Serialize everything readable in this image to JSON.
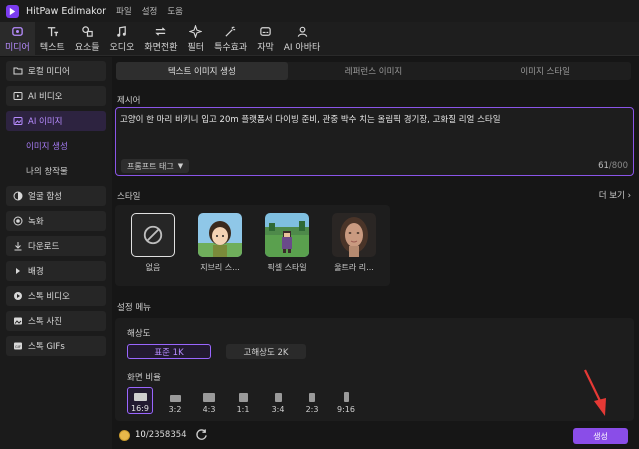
{
  "app": {
    "title": "HitPaw Edimakor",
    "menus": [
      "파일",
      "설정",
      "도움"
    ]
  },
  "toolbar": {
    "items": [
      {
        "label": "미디어",
        "icon": "media-icon",
        "active": true
      },
      {
        "label": "텍스트",
        "icon": "text-icon"
      },
      {
        "label": "요소들",
        "icon": "elements-icon"
      },
      {
        "label": "오디오",
        "icon": "audio-icon"
      },
      {
        "label": "화면전환",
        "icon": "transition-icon"
      },
      {
        "label": "필터",
        "icon": "filter-icon"
      },
      {
        "label": "특수효과",
        "icon": "effects-icon"
      },
      {
        "label": "자막",
        "icon": "subtitle-icon"
      },
      {
        "label": "AI 아바타",
        "icon": "avatar-icon"
      }
    ]
  },
  "sidebar": {
    "items": [
      {
        "label": "로컬 미디어",
        "icon": "folder-icon"
      },
      {
        "label": "AI 비디오",
        "icon": "ai-video-icon"
      },
      {
        "label": "AI 이미지",
        "icon": "ai-image-icon",
        "active": true
      },
      {
        "label": "이미지 생성",
        "sub": true,
        "active": true
      },
      {
        "label": "나의 창작물",
        "sub": true
      },
      {
        "label": "얼굴 합성",
        "icon": "face-swap-icon"
      },
      {
        "label": "녹화",
        "icon": "record-icon"
      },
      {
        "label": "다운로드",
        "icon": "download-icon"
      },
      {
        "label": "배경",
        "icon": "background-icon"
      },
      {
        "label": "스톡 비디오",
        "icon": "stock-video-icon"
      },
      {
        "label": "스톡 사진",
        "icon": "stock-photo-icon"
      },
      {
        "label": "스톡 GIFs",
        "icon": "gif-icon"
      }
    ]
  },
  "tabs": [
    "텍스트 이미지 생성",
    "레퍼런스 이미지",
    "이미지 스타일"
  ],
  "prompt": {
    "label": "제시어",
    "text": "고양이 한 마리 비키니 입고 20m 플랫폼서 다이빙 준비, 관중 박수 치는 올림픽 경기장, 고화질 리얼 스타일",
    "tag_button": "프롬프트 태그",
    "count": "61",
    "max": "/800"
  },
  "style": {
    "label": "스타일",
    "more": "더 보기",
    "options": [
      {
        "name": "없음",
        "selected": true
      },
      {
        "name": "지브리 스..."
      },
      {
        "name": "픽셀 스타일"
      },
      {
        "name": "울트라 리..."
      }
    ]
  },
  "settings": {
    "label": "설정 메뉴",
    "resolution_label": "해상도",
    "resolutions": [
      "표준 1K",
      "고해상도 2K"
    ],
    "ratio_label": "화면 비율",
    "ratios": [
      "16:9",
      "3:2",
      "4:3",
      "1:1",
      "3:4",
      "2:3",
      "9:16"
    ],
    "selected_ratio": "16:9"
  },
  "footer": {
    "credits_used": "10",
    "credits_total": "/2358354",
    "generate": "생성"
  },
  "colors": {
    "accent": "#8a4de8",
    "arrow": "#e53935"
  }
}
